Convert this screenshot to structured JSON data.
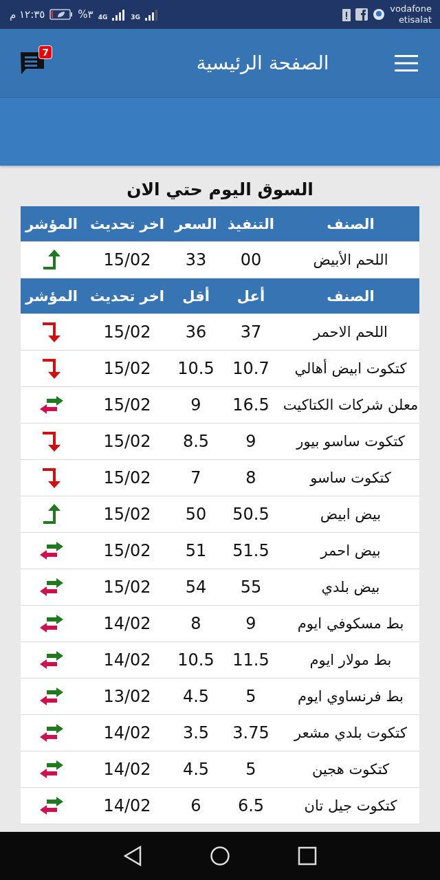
{
  "status_bar": {
    "time": "١٢:٣٥ م",
    "battery": "٣%",
    "network_1": "4G",
    "network_2": "3G",
    "carrier_1": "vodafone",
    "carrier_2": "etisalat"
  },
  "app_bar": {
    "title": "الصفحة الرئيسية",
    "messages_badge": "7"
  },
  "section_title": "السوق اليوم حتي الان",
  "table_1": {
    "columns": [
      "الصنف",
      "التنفيذ",
      "السعر",
      "اخر تحديث",
      "المؤشر"
    ],
    "rows": [
      {
        "item": "اللحم الأبيض",
        "column_2": "00",
        "column_3": "33",
        "date": "15/02",
        "kind": "up"
      }
    ]
  },
  "table_2": {
    "columns": [
      "الصنف",
      "أعل",
      "أقل",
      "اخر تحديث",
      "المؤشر"
    ],
    "rows": [
      {
        "item": "اللحم الاحمر",
        "high": "37",
        "low": "36",
        "date": "15/02",
        "kind": "down"
      },
      {
        "item": "كتكوت ابيض أهالي",
        "high": "10.7",
        "low": "10.5",
        "date": "15/02",
        "kind": "down"
      },
      {
        "item": "معلن شركات الكتاكيت",
        "high": "16.5",
        "low": "9",
        "date": "15/02",
        "kind": "flat"
      },
      {
        "item": "كتكوت ساسو بيور",
        "high": "9",
        "low": "8.5",
        "date": "15/02",
        "kind": "down"
      },
      {
        "item": "كتكوت ساسو",
        "high": "8",
        "low": "7",
        "date": "15/02",
        "kind": "down"
      },
      {
        "item": "بيض ابيض",
        "high": "50.5",
        "low": "50",
        "date": "15/02",
        "kind": "up"
      },
      {
        "item": "بيض احمر",
        "high": "51.5",
        "low": "51",
        "date": "15/02",
        "kind": "flat"
      },
      {
        "item": "بيض بلدي",
        "high": "55",
        "low": "54",
        "date": "15/02",
        "kind": "flat"
      },
      {
        "item": "بط مسكوفي ايوم",
        "high": "9",
        "low": "8",
        "date": "14/02",
        "kind": "flat"
      },
      {
        "item": "بط مولار ايوم",
        "high": "11.5",
        "low": "10.5",
        "date": "14/02",
        "kind": "flat"
      },
      {
        "item": "بط فرنساوي ايوم",
        "high": "5",
        "low": "4.5",
        "date": "13/02",
        "kind": "flat"
      },
      {
        "item": "كتكوت بلدي مشعر",
        "high": "3.75",
        "low": "3.5",
        "date": "14/02",
        "kind": "flat"
      },
      {
        "item": "كتكوت هجين",
        "high": "5",
        "low": "4.5",
        "date": "14/02",
        "kind": "flat"
      },
      {
        "item": "كتكوت جيل تان",
        "high": "6.5",
        "low": "6",
        "date": "14/02",
        "kind": "flat"
      }
    ]
  }
}
